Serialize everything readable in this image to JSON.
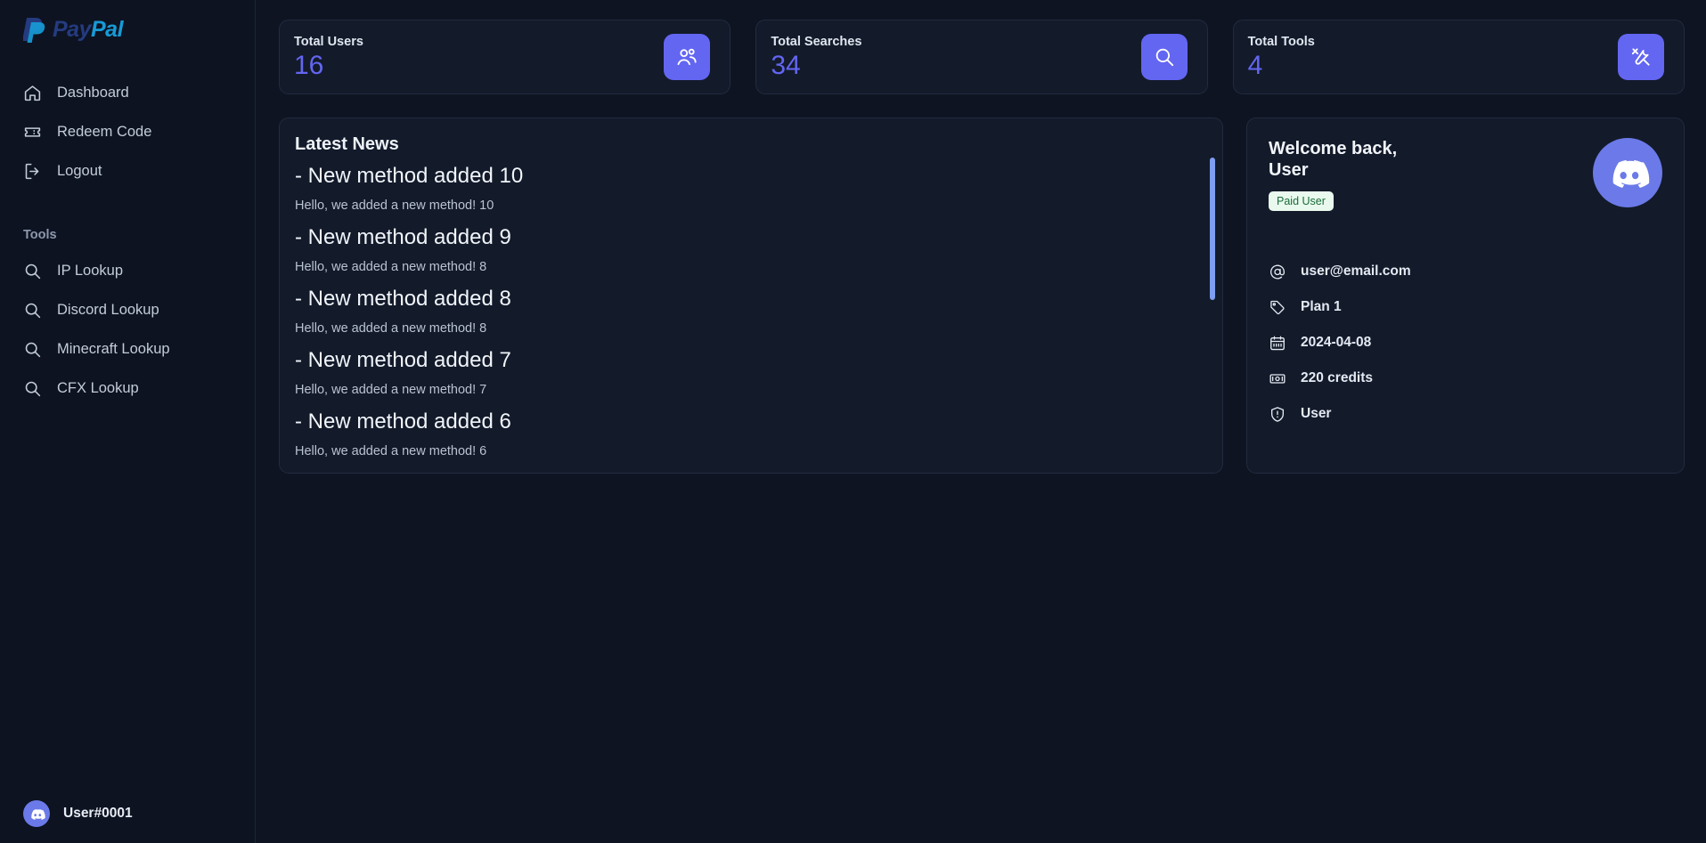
{
  "brand": {
    "pay": "Pay",
    "pal": "Pal"
  },
  "sidebar": {
    "nav": [
      {
        "label": "Dashboard",
        "icon": "home-icon"
      },
      {
        "label": "Redeem Code",
        "icon": "ticket-icon"
      },
      {
        "label": "Logout",
        "icon": "logout-icon"
      }
    ],
    "tools_label": "Tools",
    "tools": [
      {
        "label": "IP Lookup",
        "icon": "search-icon"
      },
      {
        "label": "Discord Lookup",
        "icon": "search-icon"
      },
      {
        "label": "Minecraft Lookup",
        "icon": "search-icon"
      },
      {
        "label": "CFX Lookup",
        "icon": "search-icon"
      }
    ],
    "footer_user": "User#0001",
    "footer_avatar_icon": "discord-icon"
  },
  "stats": [
    {
      "label": "Total Users",
      "value": "16",
      "icon": "users-icon"
    },
    {
      "label": "Total Searches",
      "value": "34",
      "icon": "search-icon"
    },
    {
      "label": "Total Tools",
      "value": "4",
      "icon": "tools-icon"
    }
  ],
  "news": {
    "title": "Latest News",
    "items": [
      {
        "heading": "- New method added 10",
        "body": "Hello, we added a new method! 10"
      },
      {
        "heading": "- New method added 9",
        "body": "Hello, we added a new method! 8"
      },
      {
        "heading": "- New method added 8",
        "body": "Hello, we added a new method! 8"
      },
      {
        "heading": "- New method added 7",
        "body": "Hello, we added a new method! 7"
      },
      {
        "heading": "- New method added 6",
        "body": "Hello, we added a new method! 6"
      }
    ]
  },
  "profile": {
    "welcome": "Welcome back,",
    "username": "User",
    "badge": "Paid User",
    "avatar_icon": "discord-icon",
    "info": [
      {
        "icon": "at-sign-icon",
        "value": "user@email.com"
      },
      {
        "icon": "tag-icon",
        "value": "Plan 1"
      },
      {
        "icon": "calendar-icon",
        "value": "2024-04-08"
      },
      {
        "icon": "banknote-icon",
        "value": "220 credits"
      },
      {
        "icon": "shield-alert-icon",
        "value": "User"
      }
    ]
  },
  "colors": {
    "accent": "#6366f1",
    "page_bg": "#0e1422",
    "card_bg": "#131a2a",
    "badge_bg": "#e9f9ee",
    "badge_text": "#1b6b3a",
    "discord": "#6b7ae8",
    "scrollbar": "#7e9df0"
  }
}
